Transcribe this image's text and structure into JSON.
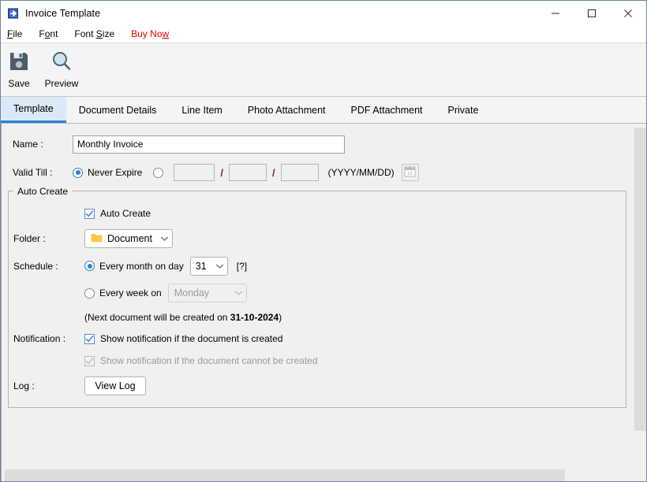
{
  "window": {
    "title": "Invoice Template",
    "icon": "export-arrow-icon",
    "minimize_label": "—",
    "maximize_label": "□",
    "close_label": "✕"
  },
  "menu": {
    "items": [
      {
        "label": "File",
        "mnemonic_index": 0,
        "color": "#000000"
      },
      {
        "label": "Font",
        "mnemonic_index": 1,
        "color": "#000000"
      },
      {
        "label": "Font Size",
        "mnemonic_index": 5,
        "color": "#000000"
      },
      {
        "label": "Buy Now",
        "mnemonic_index": 5,
        "color": "#e50000"
      }
    ]
  },
  "toolbar": {
    "save_label": "Save",
    "save_icon": "floppy-disk-icon",
    "preview_label": "Preview",
    "preview_icon": "magnifier-icon"
  },
  "tabs": {
    "active_index": 0,
    "items": [
      {
        "label": "Template"
      },
      {
        "label": "Document Details"
      },
      {
        "label": "Line Item"
      },
      {
        "label": "Photo Attachment"
      },
      {
        "label": "PDF Attachment"
      },
      {
        "label": "Private"
      }
    ]
  },
  "form": {
    "name": {
      "label": "Name :",
      "value": "Monthly Invoice",
      "placeholder": ""
    },
    "valid_till": {
      "label": "Valid Till :",
      "never_expire_label": "Never Expire",
      "never_expire_selected": true,
      "date_selected": false,
      "year_value": "",
      "month_value": "",
      "day_value": "",
      "separator": "/",
      "format_hint": "(YYYY/MM/DD)",
      "calendar_icon": "calendar-icon",
      "calendar_icon_day": "12"
    },
    "auto_create_group": {
      "title": "Auto Create",
      "auto_create_checkbox": {
        "label": "Auto Create",
        "checked": true
      },
      "folder": {
        "label": "Folder :",
        "value": "Document",
        "icon": "folder-icon"
      },
      "schedule": {
        "label": "Schedule :",
        "monthly": {
          "label": "Every month on day",
          "selected": true,
          "day_value": "31",
          "help_label": "[?]"
        },
        "weekly": {
          "label": "Every week on",
          "selected": false,
          "day_value": "Monday",
          "disabled": true
        },
        "next_doc_prefix": "(Next document will be created on ",
        "next_doc_date": "31-10-2024",
        "next_doc_suffix": ")"
      },
      "notification": {
        "label": "Notification :",
        "created": {
          "label": "Show notification if the document is created",
          "checked": true,
          "disabled": false
        },
        "cannot_create": {
          "label": "Show notification if the document cannot be created",
          "checked": true,
          "disabled": true
        }
      },
      "log": {
        "label": "Log :",
        "button_label": "View Log"
      }
    }
  },
  "colors": {
    "accent": "#2f7fd0",
    "active_tab_bg": "#d9e9f7",
    "buy_now": "#e50000",
    "panel_bg": "#f0f0f0",
    "folder_yellow": "#ffc83d"
  }
}
